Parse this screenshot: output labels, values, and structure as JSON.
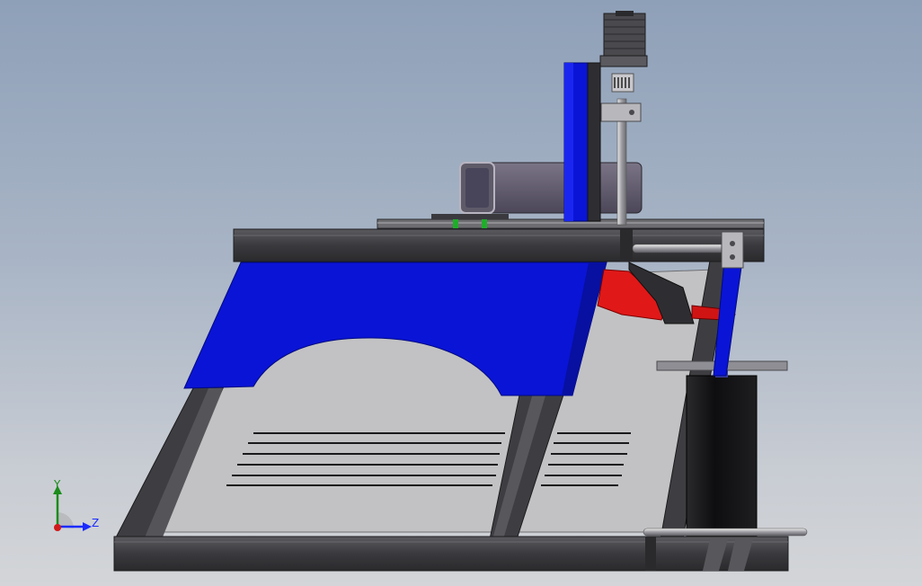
{
  "viewport": {
    "background_top": "#8ea0b8",
    "background_bottom": "#d3d5d8"
  },
  "model": {
    "frame_color": "#3e3e42",
    "cover_color": "#0a14d6",
    "bed_color": "#c2c2c4",
    "motor_color": "#4a4a4e",
    "nozzle_color": "#e01818",
    "spindle_color": "#101012"
  },
  "triad": {
    "y_label": "Y",
    "z_label": "Z",
    "y_color": "#1b8c1b",
    "z_color": "#1a2bff",
    "x_color": "#d11a1a"
  }
}
